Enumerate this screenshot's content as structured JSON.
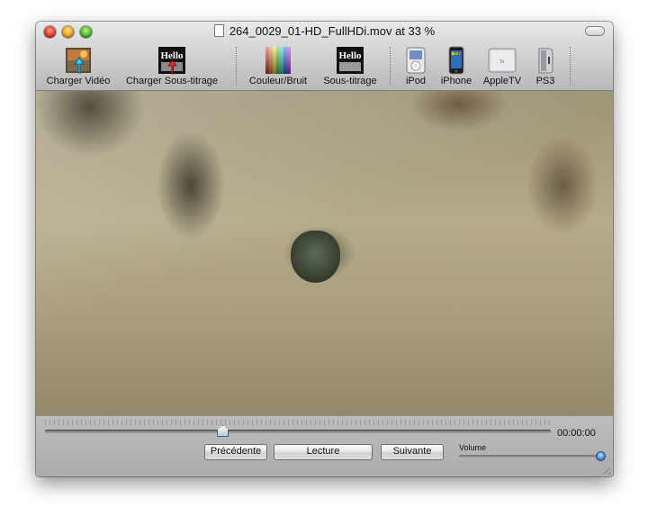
{
  "window": {
    "title": "264_0029_01-HD_FullHDi.mov at  33 %"
  },
  "toolbar": {
    "items": [
      {
        "label": "Charger Vidéo",
        "icon": "load-video-icon"
      },
      {
        "label": "Charger Sous-titrage",
        "icon": "load-subtitles-icon"
      },
      {
        "label": "Couleur/Bruit",
        "icon": "color-noise-icon"
      },
      {
        "label": "Sous-titrage",
        "icon": "subtitles-icon"
      },
      {
        "label": "iPod",
        "icon": "ipod-icon"
      },
      {
        "label": "iPhone",
        "icon": "iphone-icon"
      },
      {
        "label": "AppleTV",
        "icon": "appletv-icon"
      },
      {
        "label": "PS3",
        "icon": "ps3-icon"
      }
    ],
    "hello_text": "Hello"
  },
  "controls": {
    "time": "00:00:00",
    "position_fraction": 0.35,
    "prev_label": "Précédente",
    "play_label": "Lecture",
    "next_label": "Suivante",
    "volume_label": "Volume",
    "volume_fraction": 1.0
  }
}
